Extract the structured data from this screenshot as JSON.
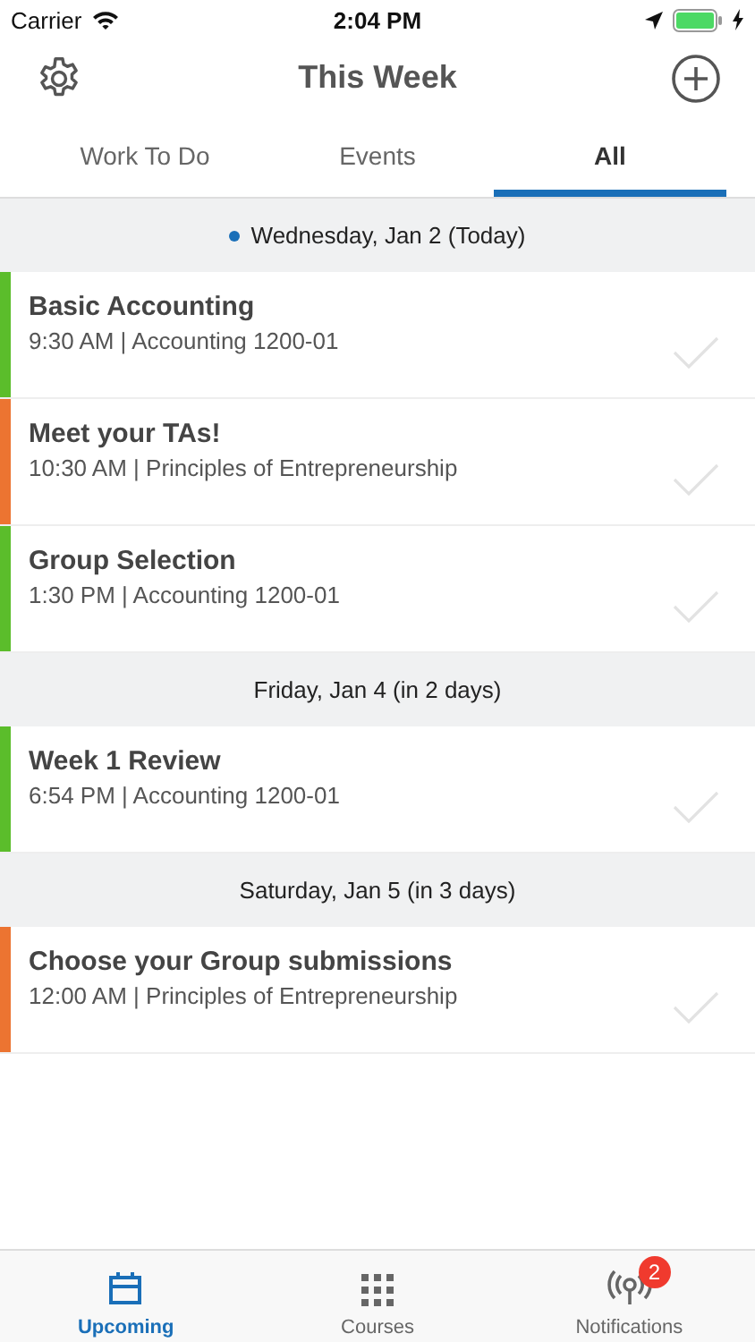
{
  "status_bar": {
    "carrier": "Carrier",
    "time": "2:04 PM"
  },
  "nav": {
    "title": "This Week"
  },
  "tabs": [
    {
      "label": "Work To Do",
      "selected": false
    },
    {
      "label": "Events",
      "selected": false
    },
    {
      "label": "All",
      "selected": true
    }
  ],
  "days": [
    {
      "heading": "Wednesday, Jan 2 (Today)",
      "today": true,
      "items": [
        {
          "title": "Basic Accounting",
          "subtitle": "9:30 AM | Accounting 1200-01",
          "color": "#5bbd2b"
        },
        {
          "title": "Meet your TAs!",
          "subtitle": "10:30 AM | Principles of Entrepreneurship",
          "color": "#ec7431"
        },
        {
          "title": "Group Selection",
          "subtitle": "1:30 PM | Accounting 1200-01",
          "color": "#5bbd2b"
        }
      ]
    },
    {
      "heading": "Friday, Jan 4 (in 2 days)",
      "today": false,
      "items": [
        {
          "title": "Week 1 Review",
          "subtitle": "6:54 PM | Accounting 1200-01",
          "color": "#5bbd2b"
        }
      ]
    },
    {
      "heading": "Saturday, Jan 5 (in 3 days)",
      "today": false,
      "items": [
        {
          "title": "Choose your Group submissions",
          "subtitle": "12:00 AM | Principles of Entrepreneurship",
          "color": "#ec7431"
        }
      ]
    }
  ],
  "tab_bar": [
    {
      "kind": "calendar",
      "label": "Upcoming",
      "selected": true
    },
    {
      "kind": "grid",
      "label": "Courses",
      "selected": false
    },
    {
      "kind": "broadcast",
      "label": "Notifications",
      "selected": false,
      "badge": "2"
    }
  ]
}
